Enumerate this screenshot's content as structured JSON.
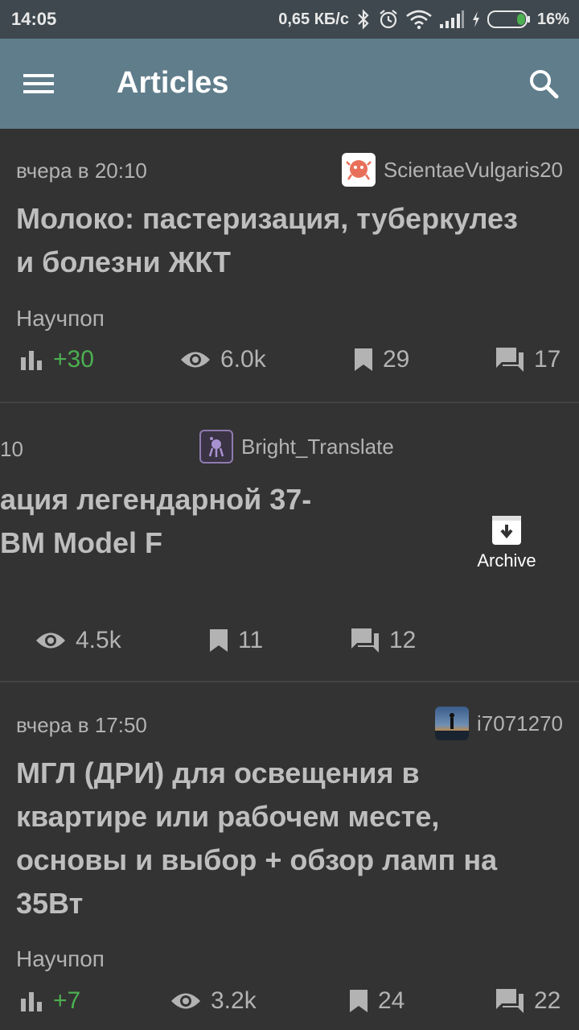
{
  "status_bar": {
    "time": "14:05",
    "speed": "0,65 КБ/с",
    "battery": "16%"
  },
  "app_bar": {
    "title": "Articles",
    "menu_icon": "hamburger-menu-icon",
    "search_icon": "search-icon"
  },
  "articles": [
    {
      "date": "вчера в 20:10",
      "author": "ScientaeVulgaris20",
      "title_lines": [
        "Молоко: пастеризация, туберкулез",
        "и болезни ЖКТ"
      ],
      "hub": "Научпоп",
      "rating": "+30",
      "views": "6.0k",
      "bookmarks": "29",
      "comments": "17"
    },
    {
      "date": "10",
      "author": "Bright_Translate",
      "title_lines": [
        "ация легендарной 37-",
        "BM Model F"
      ],
      "views": "4.5k",
      "bookmarks": "11",
      "comments": "12",
      "swipe_action": "Archive"
    },
    {
      "date": "вчера в 17:50",
      "author": "i7071270",
      "title_lines": [
        "МГЛ (ДРИ) для освещения в",
        "квартире или рабочем месте,",
        "основы и выбор + обзор ламп на",
        "35Вт"
      ],
      "hub": "Научпоп",
      "rating": "+7",
      "views": "3.2k",
      "bookmarks": "24",
      "comments": "22"
    }
  ],
  "colors": {
    "app_bar": "#607d8b",
    "status_bar": "#3e484e",
    "background": "#333333",
    "rating_positive": "#4caf50"
  }
}
